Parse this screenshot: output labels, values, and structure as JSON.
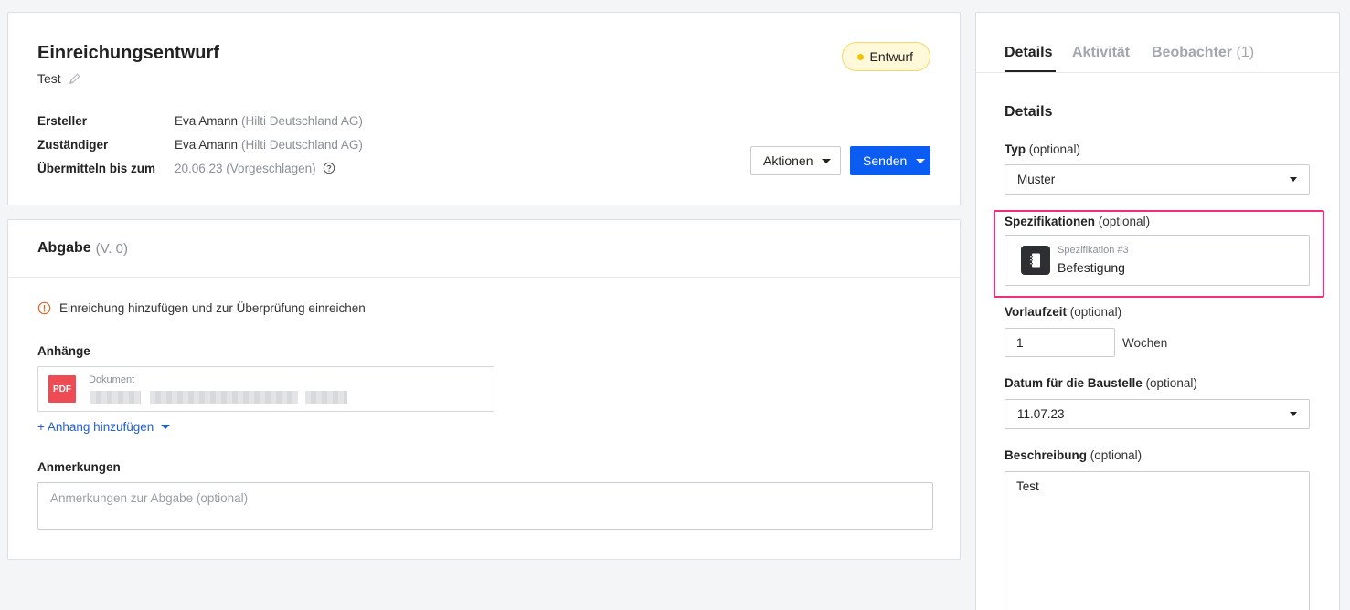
{
  "header": {
    "title": "Einreichungsentwurf",
    "subtitle": "Test",
    "status": "Entwurf",
    "status_color": "#f4c200",
    "meta": {
      "creator_label": "Ersteller",
      "creator_name": "Eva Amann",
      "creator_org": "(Hilti Deutschland AG)",
      "assignee_label": "Zuständiger",
      "assignee_name": "Eva Amann",
      "assignee_org": "(Hilti Deutschland AG)",
      "due_label": "Übermitteln bis zum",
      "due_value": "20.06.23 (Vorgeschlagen)"
    },
    "actions_label": "Aktionen",
    "send_label": "Senden",
    "accent_color": "#0b5cf2"
  },
  "submission": {
    "title": "Abgabe",
    "version": "(V. 0)",
    "notice": "Einreichung hinzufügen und zur Überprüfung einreichen",
    "attachments_label": "Anhänge",
    "attachment": {
      "icon_text": "PDF",
      "type_label": "Dokument"
    },
    "add_attachment_label": "+ Anhang hinzufügen",
    "notes_label": "Anmerkungen",
    "notes_placeholder": "Anmerkungen zur Abgabe (optional)"
  },
  "panel": {
    "tabs": {
      "details": "Details",
      "activity": "Aktivität",
      "watchers": "Beobachter",
      "watchers_count": "(1)"
    },
    "heading": "Details",
    "type_label": "Typ",
    "type_opt": "(optional)",
    "type_value": "Muster",
    "spec_label": "Spezifikationen",
    "spec_opt": "(optional)",
    "spec_number": "Spezifikation #3",
    "spec_name": "Befestigung",
    "lead_label": "Vorlaufzeit",
    "lead_opt": "(optional)",
    "lead_value": "1",
    "lead_unit": "Wochen",
    "site_date_label": "Datum für die Baustelle",
    "site_date_opt": "(optional)",
    "site_date_value": "11.07.23",
    "desc_label": "Beschreibung",
    "desc_opt": "(optional)",
    "desc_value": "Test",
    "highlight_color": "#ef2f7c"
  }
}
